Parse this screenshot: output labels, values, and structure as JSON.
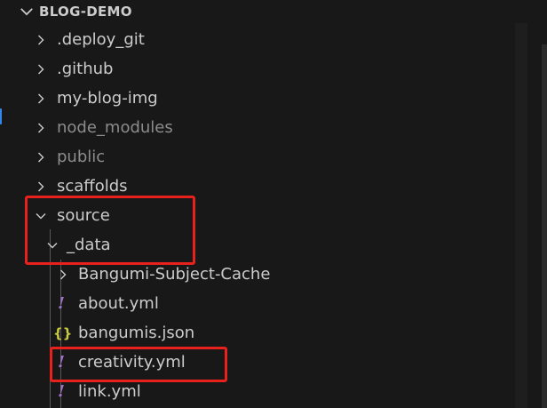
{
  "explorer": {
    "section_title": "BLOG-DEMO",
    "items": [
      {
        "label": ".deploy_git",
        "kind": "folder",
        "state": "collapsed"
      },
      {
        "label": ".github",
        "kind": "folder",
        "state": "collapsed"
      },
      {
        "label": "my-blog-img",
        "kind": "folder",
        "state": "collapsed"
      },
      {
        "label": "node_modules",
        "kind": "folder",
        "state": "collapsed",
        "dimmed": true
      },
      {
        "label": "public",
        "kind": "folder",
        "state": "collapsed",
        "dimmed": true
      },
      {
        "label": "scaffolds",
        "kind": "folder",
        "state": "collapsed"
      },
      {
        "label": "source",
        "kind": "folder",
        "state": "expanded"
      },
      {
        "label": "_data",
        "kind": "folder",
        "state": "expanded"
      },
      {
        "label": "Bangumi-Subject-Cache",
        "kind": "folder",
        "state": "collapsed"
      },
      {
        "label": "about.yml",
        "kind": "file",
        "icon": "yaml-icon",
        "icon_glyph": "!"
      },
      {
        "label": "bangumis.json",
        "kind": "file",
        "icon": "json-icon",
        "icon_glyph": "{}"
      },
      {
        "label": "creativity.yml",
        "kind": "file",
        "icon": "yaml-icon",
        "icon_glyph": "!"
      },
      {
        "label": "link.yml",
        "kind": "file",
        "icon": "yaml-icon",
        "icon_glyph": "!"
      }
    ]
  },
  "colors": {
    "background": "#181818",
    "text": "#cccccc",
    "dim_text": "#8c8c8c",
    "yaml_icon": "#a074c4",
    "json_icon": "#cbcb41",
    "annotation": "#e8211d"
  }
}
